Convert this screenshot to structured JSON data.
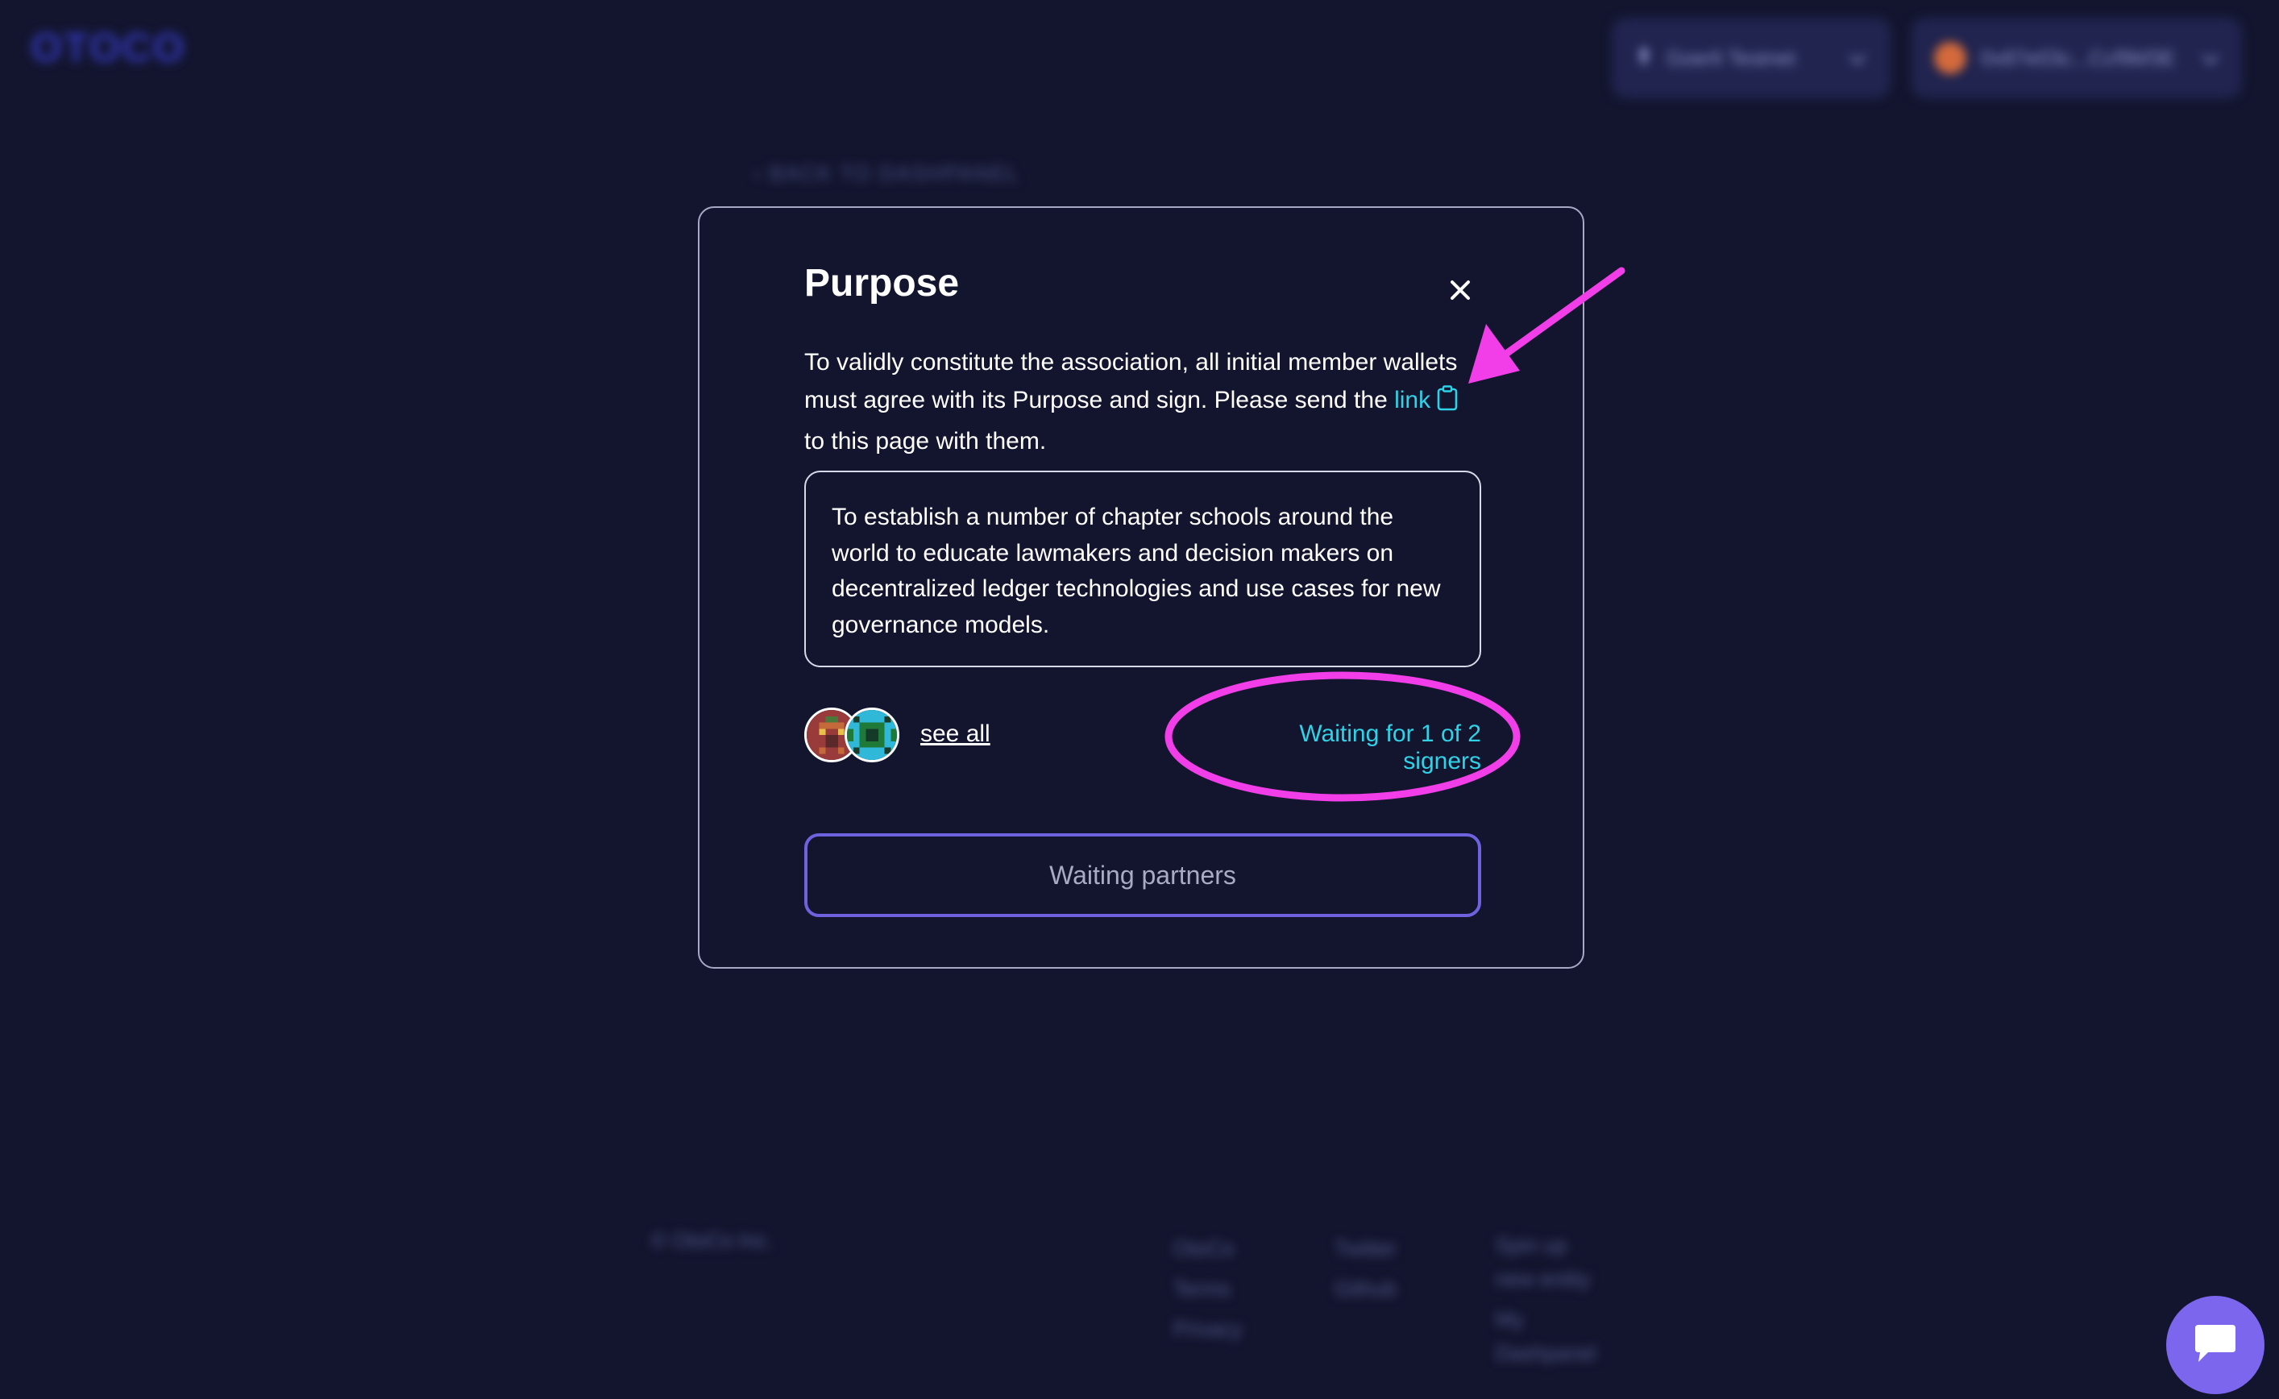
{
  "header": {
    "logo": "OTOCO",
    "network_label": "Goerli Testnet",
    "wallet_label": "0x87e03c...Ccf9bf3E"
  },
  "page": {
    "back_link": "BACK TO DASHPANEL"
  },
  "footer": {
    "copyright": "© OtoCo Inc.",
    "col1": [
      "OtoCo",
      "Terms",
      "Privacy"
    ],
    "col2": [
      "Twitter",
      "Github"
    ],
    "col3": [
      "Spin up",
      "new entity",
      "My",
      "Dashpanel"
    ]
  },
  "modal": {
    "title": "Purpose",
    "intro_before": "To validly constitute the association, all initial member wallets must agree with its Purpose and sign. Please send the ",
    "intro_link": "link",
    "intro_after": " to this page with them.",
    "purpose_text": "To establish a number of chapter schools around the world to educate lawmakers and decision makers on decentralized ledger technologies and use cases for new governance models.",
    "see_all": "see all",
    "status": "Waiting for 1 of 2 signers",
    "button_label": "Waiting partners"
  },
  "annotation": {
    "color": "#f23ee8"
  },
  "colors": {
    "background": "#13152f",
    "accent_cyan": "#2ed3e8",
    "button_border": "#6e62df",
    "chat_bubble": "#7c66ee"
  }
}
